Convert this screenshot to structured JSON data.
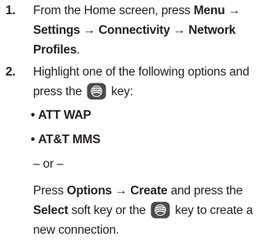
{
  "step1": {
    "number": "1.",
    "text_a": "From the Home screen, press ",
    "menu": "Menu",
    "arrow1": " → ",
    "settings": "Settings",
    "arrow2": " → ",
    "connectivity": "Connectivity",
    "arrow3": " → ",
    "network": "Network",
    "profiles": "Profiles",
    "period": "."
  },
  "step2": {
    "number": "2.",
    "line1": "Highlight one of the following options and",
    "press_the": "press the ",
    "key_suffix": " key:",
    "bullets": [
      {
        "dot": "•",
        "label": "ATT WAP"
      },
      {
        "dot": "•",
        "label": "AT&T MMS"
      }
    ],
    "or_text": "– or –",
    "press": "Press ",
    "options": "Options",
    "arrow": " → ",
    "create": "Create",
    "and_press_the": " and press the",
    "select": "Select",
    "soft_key_text": " soft key or the ",
    "key_to_create": " key to create a",
    "new_connection": "new connection."
  },
  "icons": {
    "nav_key_icon": "select-key-icon"
  }
}
